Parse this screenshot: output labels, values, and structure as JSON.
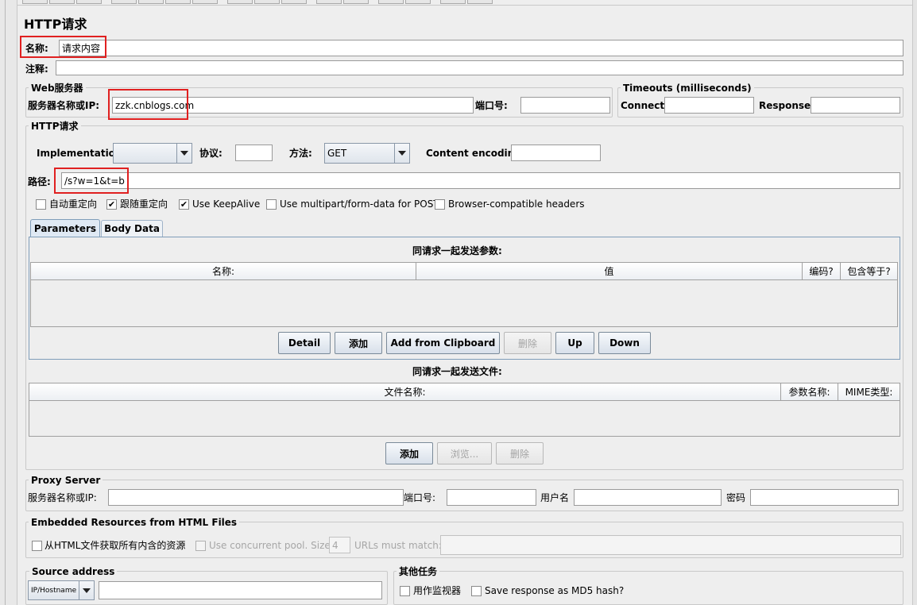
{
  "panel_title": "HTTP请求",
  "name_label": "名称:",
  "name_value": "请求内容",
  "comment_label": "注释:",
  "comment_value": "",
  "web_server": {
    "title": "Web服务器",
    "server_label": "服务器名称或IP:",
    "server_value": "zzk.cnblogs.com",
    "port_label": "端口号:",
    "port_value": ""
  },
  "timeouts": {
    "title": "Timeouts (milliseconds)",
    "connect_label": "Connect:",
    "connect_value": "",
    "response_label": "Response:",
    "response_value": ""
  },
  "http_request": {
    "title": "HTTP请求",
    "implementation_label": "Implementation:",
    "implementation_value": "",
    "protocol_label": "协议:",
    "protocol_value": "",
    "method_label": "方法:",
    "method_value": "GET",
    "encoding_label": "Content encoding:",
    "encoding_value": "",
    "path_label": "路径:",
    "path_value": "/s?w=1&t=b",
    "options": [
      {
        "label": "自动重定向",
        "checked": false
      },
      {
        "label": "跟随重定向",
        "checked": true
      },
      {
        "label": "Use KeepAlive",
        "checked": true
      },
      {
        "label": "Use multipart/form-data for POST",
        "checked": false
      },
      {
        "label": "Browser-compatible headers",
        "checked": false
      }
    ]
  },
  "tabs": [
    {
      "label": "Parameters",
      "active": true
    },
    {
      "label": "Body Data",
      "active": false
    }
  ],
  "params": {
    "caption": "同请求一起发送参数:",
    "columns": [
      "名称:",
      "值",
      "编码?",
      "包含等于?"
    ],
    "rows": [],
    "buttons": [
      {
        "label": "Detail",
        "enabled": true
      },
      {
        "label": "添加",
        "enabled": true
      },
      {
        "label": "Add from Clipboard",
        "enabled": true
      },
      {
        "label": "删除",
        "enabled": false
      },
      {
        "label": "Up",
        "enabled": true
      },
      {
        "label": "Down",
        "enabled": true
      }
    ]
  },
  "files": {
    "caption": "同请求一起发送文件:",
    "columns": [
      "文件名称:",
      "参数名称:",
      "MIME类型:"
    ],
    "buttons": [
      {
        "label": "添加",
        "enabled": true
      },
      {
        "label": "浏览...",
        "enabled": false
      },
      {
        "label": "删除",
        "enabled": false
      }
    ]
  },
  "proxy": {
    "title": "Proxy Server",
    "server_label": "服务器名称或IP:",
    "port_label": "端口号:",
    "user_label": "用户名",
    "password_label": "密码"
  },
  "embedded": {
    "title": "Embedded Resources from HTML Files",
    "fetch_label": "从HTML文件获取所有内含的资源",
    "fetch_checked": false,
    "pool_label": "Use concurrent pool. Size:",
    "pool_size": "4",
    "urls_label": "URLs must match:",
    "urls_value": ""
  },
  "source": {
    "title": "Source address",
    "type_value": "IP/Hostname",
    "address_value": ""
  },
  "other": {
    "title": "其他任务",
    "monitor_label": "用作监视器",
    "md5_label": "Save response as MD5 hash?"
  }
}
